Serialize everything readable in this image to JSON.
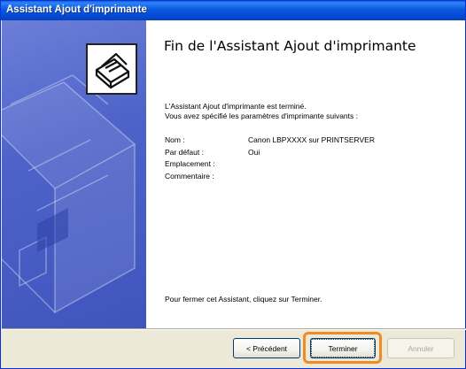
{
  "window": {
    "title": "Assistant Ajout d'imprimante"
  },
  "main": {
    "heading": "Fin de l'Assistant Ajout d'imprimante",
    "description_line1": "L'Assistant Ajout d'imprimante est terminé.",
    "description_line2": "Vous avez spécifié les paramètres d'imprimante suivants :",
    "properties": [
      {
        "label": "Nom :",
        "value": "Canon LBPXXXX sur PRINTSERVER"
      },
      {
        "label": "Par défaut :",
        "value": "Oui"
      },
      {
        "label": "Emplacement :",
        "value": ""
      },
      {
        "label": "Commentaire :",
        "value": ""
      }
    ],
    "footer": "Pour fermer cet Assistant, cliquez sur Terminer."
  },
  "buttons": {
    "previous": "< Précédent",
    "finish": "Terminer",
    "cancel": "Annuler"
  },
  "icons": {
    "wizard_icon": "printer-icon"
  },
  "colors": {
    "titlebar": "#0a58e0",
    "left_panel": "#4e63c9",
    "highlight": "#f08a24"
  }
}
